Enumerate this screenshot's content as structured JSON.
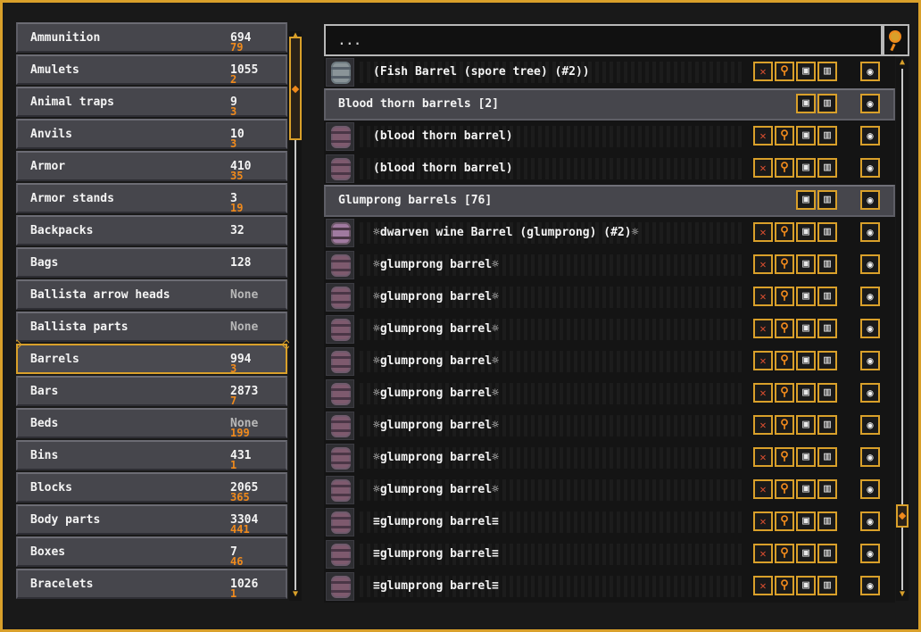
{
  "search": {
    "placeholder": "..."
  },
  "categories": [
    {
      "name": "Ammunition",
      "count": "694",
      "sub": "79"
    },
    {
      "name": "Amulets",
      "count": "1055",
      "sub": "2"
    },
    {
      "name": "Animal traps",
      "count": "9",
      "sub": "3"
    },
    {
      "name": "Anvils",
      "count": "10",
      "sub": "3"
    },
    {
      "name": "Armor",
      "count": "410",
      "sub": "35"
    },
    {
      "name": "Armor stands",
      "count": "3",
      "sub": "19"
    },
    {
      "name": "Backpacks",
      "count": "32",
      "sub": ""
    },
    {
      "name": "Bags",
      "count": "128",
      "sub": ""
    },
    {
      "name": "Ballista arrow heads",
      "count": "None",
      "sub": ""
    },
    {
      "name": "Ballista parts",
      "count": "None",
      "sub": ""
    },
    {
      "name": "Barrels",
      "count": "994",
      "sub": "3",
      "selected": true
    },
    {
      "name": "Bars",
      "count": "2873",
      "sub": "7"
    },
    {
      "name": "Beds",
      "count": "None",
      "sub": "199"
    },
    {
      "name": "Bins",
      "count": "431",
      "sub": "1"
    },
    {
      "name": "Blocks",
      "count": "2065",
      "sub": "365"
    },
    {
      "name": "Body parts",
      "count": "3304",
      "sub": "441"
    },
    {
      "name": "Boxes",
      "count": "7",
      "sub": "46"
    },
    {
      "name": "Bracelets",
      "count": "1026",
      "sub": "1"
    }
  ],
  "rows": [
    {
      "type": "item",
      "label": "(Fish Barrel (spore tree) (#2))",
      "icon": "gray-barrel-icon"
    },
    {
      "type": "group",
      "label": "Blood thorn barrels [2]"
    },
    {
      "type": "item",
      "label": "(blood thorn barrel)",
      "icon": "barrel-icon"
    },
    {
      "type": "item",
      "label": "(blood thorn barrel)",
      "icon": "barrel-icon"
    },
    {
      "type": "group",
      "label": "Glumprong barrels [76]"
    },
    {
      "type": "item",
      "label": "☼dwarven wine Barrel (glumprong) (#2)☼",
      "icon": "wine-barrel-icon"
    },
    {
      "type": "item",
      "label": "☼glumprong barrel☼",
      "icon": "barrel-icon"
    },
    {
      "type": "item",
      "label": "☼glumprong barrel☼",
      "icon": "barrel-icon"
    },
    {
      "type": "item",
      "label": "☼glumprong barrel☼",
      "icon": "barrel-icon"
    },
    {
      "type": "item",
      "label": "☼glumprong barrel☼",
      "icon": "barrel-icon"
    },
    {
      "type": "item",
      "label": "☼glumprong barrel☼",
      "icon": "barrel-icon"
    },
    {
      "type": "item",
      "label": "☼glumprong barrel☼",
      "icon": "barrel-icon"
    },
    {
      "type": "item",
      "label": "☼glumprong barrel☼",
      "icon": "barrel-icon"
    },
    {
      "type": "item",
      "label": "☼glumprong barrel☼",
      "icon": "barrel-icon"
    },
    {
      "type": "item",
      "label": "≡glumprong barrel≡",
      "icon": "barrel-icon"
    },
    {
      "type": "item",
      "label": "≡glumprong barrel≡",
      "icon": "barrel-icon"
    },
    {
      "type": "item",
      "label": "≡glumprong barrel≡",
      "icon": "barrel-icon"
    }
  ],
  "colors": {
    "accent": "#d9a02a",
    "sub_count": "#f08a1c",
    "panel": "#46464c"
  },
  "icons": {
    "filter": "✕",
    "magnify": "⚲",
    "lock": "▣",
    "trash": "▥",
    "eye": "◉"
  }
}
